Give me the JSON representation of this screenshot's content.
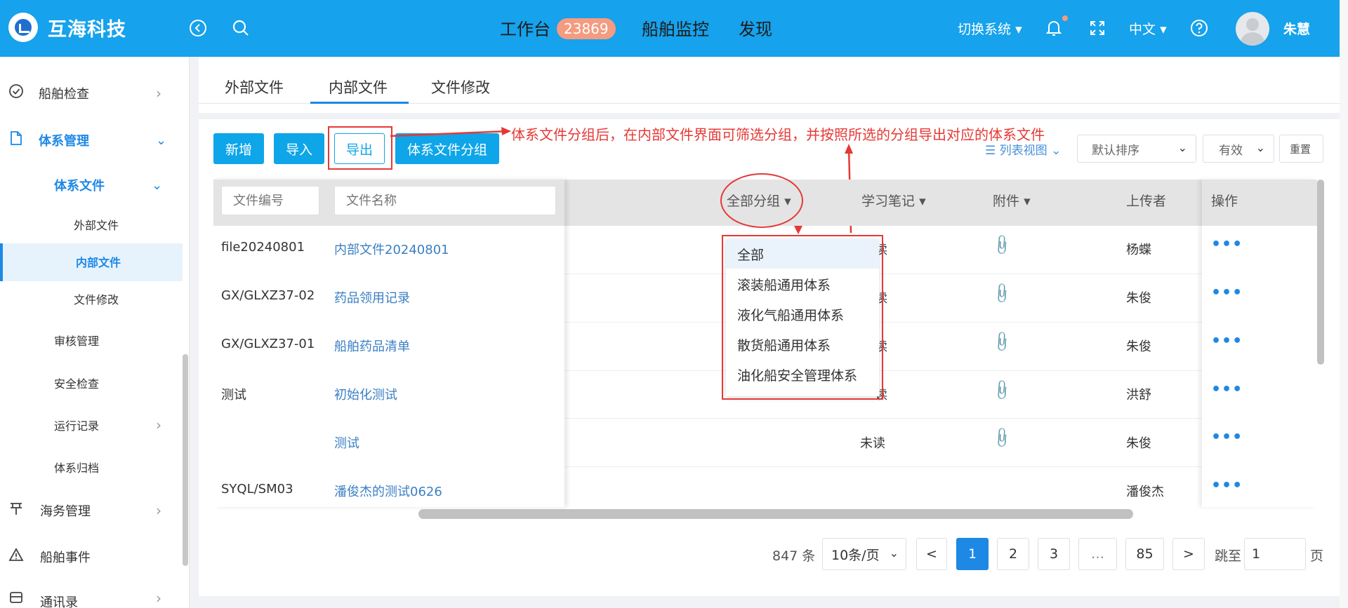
{
  "header": {
    "brand": "互海科技",
    "nav": [
      "工作台",
      "船舶监控",
      "发现"
    ],
    "badge": "23869",
    "switch_system": "切换系统",
    "language": "中文",
    "username": "朱慧",
    "icons": [
      "back-circle-icon",
      "search-icon",
      "bell-icon",
      "fullscreen-icon",
      "help-icon"
    ]
  },
  "sidebar": {
    "items": [
      {
        "label": "船舶检查",
        "icon": "check-circle-icon"
      },
      {
        "label": "体系管理",
        "icon": "document-icon"
      },
      {
        "label": "体系文件"
      },
      {
        "label": "外部文件"
      },
      {
        "label": "内部文件"
      },
      {
        "label": "文件修改"
      },
      {
        "label": "审核管理"
      },
      {
        "label": "安全检查"
      },
      {
        "label": "运行记录"
      },
      {
        "label": "体系归档"
      },
      {
        "label": "海务管理",
        "icon": "ship-icon"
      },
      {
        "label": "船舶事件",
        "icon": "warning-icon"
      },
      {
        "label": "通讯录",
        "icon": "contacts-icon"
      }
    ]
  },
  "tabs": [
    "外部文件",
    "内部文件",
    "文件修改"
  ],
  "toolbar": {
    "add": "新增",
    "import": "导入",
    "export": "导出",
    "group": "体系文件分组",
    "annotation": "体系文件分组后，在内部文件界面可筛选分组，并按照所选的分组导出对应的体系文件",
    "list_view": "列表视图",
    "sort": "默认排序",
    "status": "有效",
    "reset": "重置"
  },
  "table": {
    "filter_code_placeholder": "文件编号",
    "filter_name_placeholder": "文件名称",
    "headers": {
      "group": "全部分组",
      "notes": "学习笔记",
      "attachment": "附件",
      "uploader": "上传者",
      "actions": "操作"
    },
    "rows": [
      {
        "code": "file20240801",
        "name": "内部文件20240801",
        "notes": "读",
        "uploader": "杨蝶"
      },
      {
        "code": "GX/GLXZ37-02",
        "name": "药品领用记录",
        "notes": "读",
        "uploader": "朱俊"
      },
      {
        "code": "GX/GLXZ37-01",
        "name": "船舶药品清单",
        "notes": "读",
        "uploader": "朱俊"
      },
      {
        "code": "测试",
        "name": "初始化测试",
        "notes": "读",
        "uploader": "洪舒"
      },
      {
        "code": "",
        "name": "测试",
        "notes": "未读",
        "uploader": "朱俊"
      },
      {
        "code": "SYQL/SM03",
        "name": "潘俊杰的测试0626",
        "notes": "",
        "uploader": "潘俊杰"
      }
    ]
  },
  "group_dropdown": [
    "全部",
    "滚装船通用体系",
    "液化气船通用体系",
    "散货船通用体系",
    "油化船安全管理体系"
  ],
  "pagination": {
    "total": "847 条",
    "page_size": "10条/页",
    "prev": "<",
    "pages": [
      "1",
      "2",
      "3",
      "…",
      "85"
    ],
    "next": ">",
    "jump_label": "跳至",
    "jump_value": "1",
    "page_suffix": "页"
  },
  "colors": {
    "primary": "#16a2ec",
    "accent": "#1e88e5",
    "annotation": "#e53935",
    "badge": "#f59b80"
  }
}
